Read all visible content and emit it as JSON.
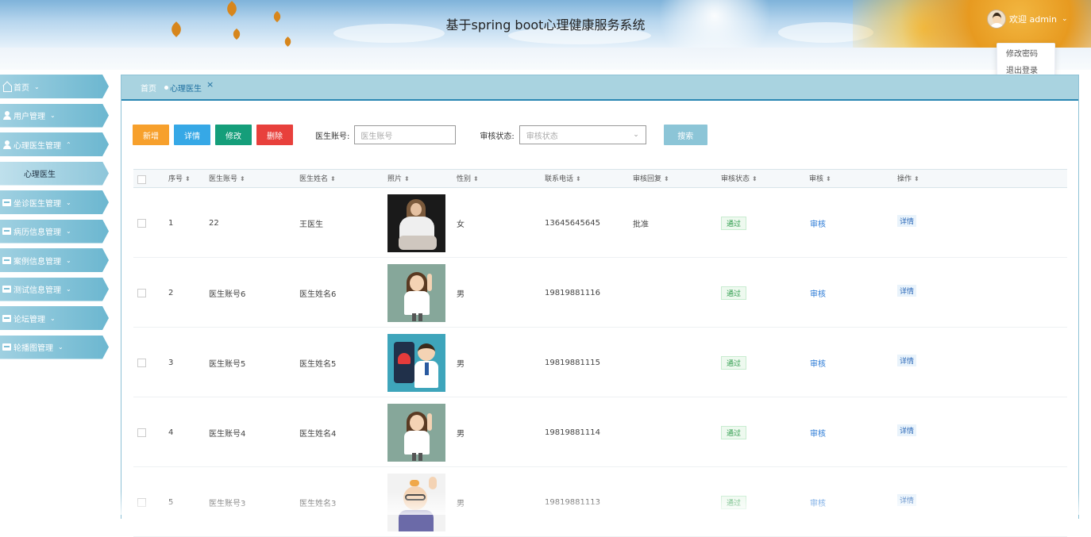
{
  "header": {
    "title": "基于spring boot心理健康服务系统",
    "welcome": "欢迎 admin",
    "avatar_icon": "user-avatar",
    "caret_icon": "chevron-down-icon"
  },
  "user_menu": {
    "items": [
      "修改密码",
      "退出登录"
    ]
  },
  "sidebar": {
    "items": [
      {
        "label": "首页",
        "icon": "home-icon",
        "chevron": "⌄"
      },
      {
        "label": "用户管理",
        "icon": "user-icon",
        "chevron": "⌄"
      },
      {
        "label": "心理医生管理",
        "icon": "user-icon",
        "chevron": "⌃"
      },
      {
        "label": "心理医生",
        "icon": "",
        "chevron": ""
      },
      {
        "label": "坐诊医生管理",
        "icon": "block-icon",
        "chevron": "⌄"
      },
      {
        "label": "病历信息管理",
        "icon": "block-icon",
        "chevron": "⌄"
      },
      {
        "label": "案例信息管理",
        "icon": "block-icon",
        "chevron": "⌄"
      },
      {
        "label": "测试信息管理",
        "icon": "block-icon",
        "chevron": "⌄"
      },
      {
        "label": "论坛管理",
        "icon": "block-icon",
        "chevron": "⌄"
      },
      {
        "label": "轮播图管理",
        "icon": "block-icon",
        "chevron": "⌄"
      }
    ]
  },
  "tabs": {
    "home": "首页",
    "active": "心理医生",
    "close": "×"
  },
  "toolbar": {
    "add": "新增",
    "detail": "详情",
    "edit": "修改",
    "delete": "删除",
    "account_label": "医生账号:",
    "account_placeholder": "医生账号",
    "status_label": "审核状态:",
    "status_placeholder": "审核状态",
    "search": "搜索"
  },
  "table": {
    "columns": [
      "序号",
      "医生账号",
      "医生姓名",
      "照片",
      "性别",
      "联系电话",
      "审核回复",
      "审核状态",
      "审核",
      "操作"
    ],
    "rows": [
      {
        "no": "1",
        "account": "22",
        "name": "王医生",
        "photo": "woman-doctor-photo",
        "gender": "女",
        "phone": "13645645645",
        "reply": "批准",
        "status": "通过",
        "audit": "审核",
        "action": "详情"
      },
      {
        "no": "2",
        "account": "医生账号6",
        "name": "医生姓名6",
        "photo": "cartoon-female-doctor",
        "gender": "男",
        "phone": "19819881116",
        "reply": "",
        "status": "通过",
        "audit": "审核",
        "action": "详情"
      },
      {
        "no": "3",
        "account": "医生账号5",
        "name": "医生姓名5",
        "photo": "cartoon-doctor-phone",
        "gender": "男",
        "phone": "19819881115",
        "reply": "",
        "status": "通过",
        "audit": "审核",
        "action": "详情"
      },
      {
        "no": "4",
        "account": "医生账号4",
        "name": "医生姓名4",
        "photo": "cartoon-female-doctor",
        "gender": "男",
        "phone": "19819881114",
        "reply": "",
        "status": "通过",
        "audit": "审核",
        "action": "详情"
      },
      {
        "no": "5",
        "account": "医生账号3",
        "name": "医生姓名3",
        "photo": "cartoon-old-doctor",
        "gender": "男",
        "phone": "19819881113",
        "reply": "",
        "status": "通过",
        "audit": "审核",
        "action": "详情"
      }
    ]
  }
}
